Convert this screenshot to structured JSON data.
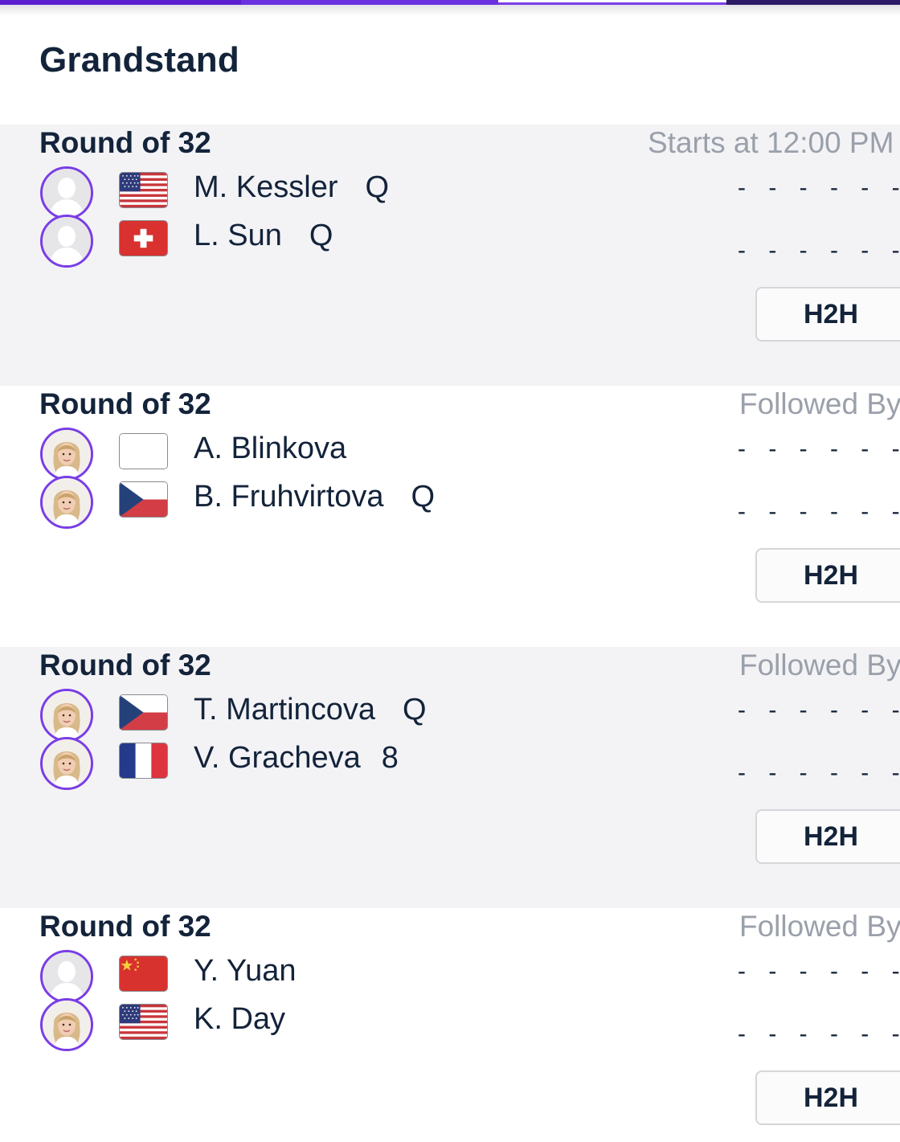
{
  "court": {
    "title": "Grandstand"
  },
  "matches": [
    {
      "round": "Round of 32",
      "status": "Starts at 12:00 PM",
      "players": [
        {
          "name": "M. Kessler",
          "seed": "Q",
          "flag": "us-flag",
          "score": "- - - - - -"
        },
        {
          "name": "L. Sun",
          "seed": "Q",
          "flag": "swiss-flag",
          "score": "- - - - - -"
        }
      ],
      "h2h_label": "H2H"
    },
    {
      "round": "Round of 32",
      "status": "Followed By",
      "players": [
        {
          "name": "A. Blinkova",
          "seed": "",
          "flag": "blank-flag",
          "score": "- - - - - -"
        },
        {
          "name": "B. Fruhvirtova",
          "seed": "Q",
          "flag": "czech-flag",
          "score": "- - - - - -"
        }
      ],
      "h2h_label": "H2H"
    },
    {
      "round": "Round of 32",
      "status": "Followed By",
      "players": [
        {
          "name": "T. Martincova",
          "seed": "Q",
          "flag": "czech-flag",
          "score": "- - - - - -"
        },
        {
          "name": "V. Gracheva",
          "seed": "8",
          "flag": "french-flag",
          "score": "- - - - - -"
        }
      ],
      "h2h_label": "H2H"
    },
    {
      "round": "Round of 32",
      "status": "Followed By",
      "players": [
        {
          "name": "Y. Yuan",
          "seed": "",
          "flag": "china-flag",
          "score": "- - - - - -"
        },
        {
          "name": "K. Day",
          "seed": "",
          "flag": "us-flag",
          "score": "- - - - - -"
        }
      ],
      "h2h_label": "H2H"
    }
  ],
  "colors": {
    "accent": "#7a3de6",
    "text": "#13233a",
    "muted": "#9aa0aa",
    "shaded_bg": "#f3f3f6"
  }
}
